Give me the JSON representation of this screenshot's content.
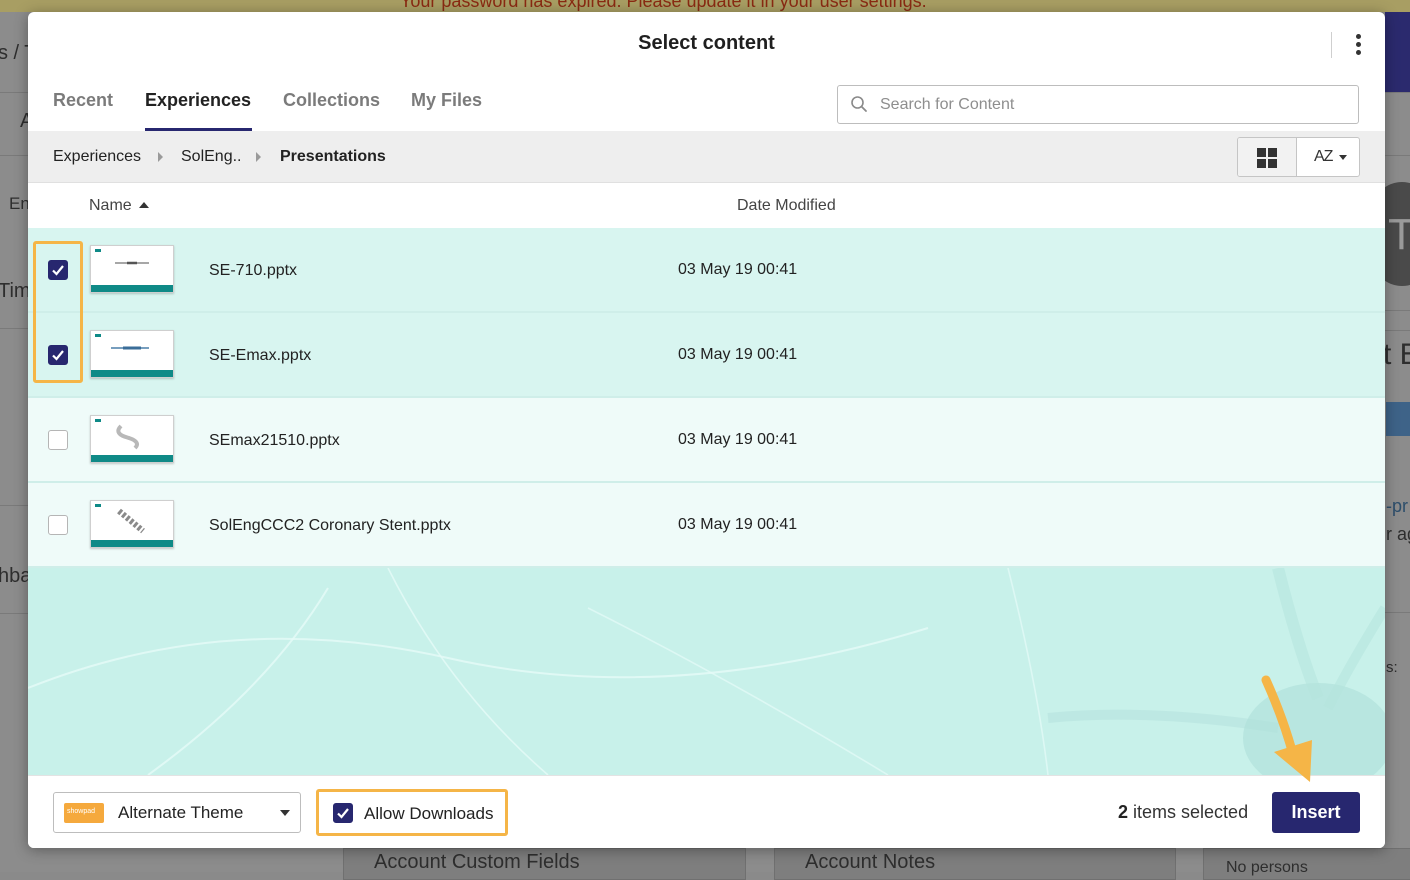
{
  "background": {
    "banner_text": "Your password has expired. Please update it in your user settings.",
    "left_fragments": [
      "s / T",
      "A",
      "En",
      "Tim",
      "hba"
    ],
    "right_fragments": [
      "T",
      "t E",
      "-pr",
      "r ag",
      "s:"
    ],
    "bottom_cards": [
      "Account Custom Fields",
      "Account Notes",
      "No persons"
    ]
  },
  "modal": {
    "title": "Select content",
    "menu_icon": "kebab-vertical-icon"
  },
  "tabs": [
    {
      "label": "Recent",
      "active": false
    },
    {
      "label": "Experiences",
      "active": true
    },
    {
      "label": "Collections",
      "active": false
    },
    {
      "label": "My Files",
      "active": false
    }
  ],
  "search": {
    "placeholder": "Search for Content",
    "value": ""
  },
  "breadcrumb": [
    "Experiences",
    "SolEng..",
    "Presentations"
  ],
  "view_controls": {
    "grid_icon": "grid-view-icon",
    "sort_label": "AZ"
  },
  "columns": {
    "name": "Name",
    "date_modified": "Date Modified"
  },
  "files": [
    {
      "name": "SE-710.pptx",
      "date": "03 May 19 00:41",
      "checked": true
    },
    {
      "name": "SE-Emax.pptx",
      "date": "03 May 19 00:41",
      "checked": true
    },
    {
      "name": "SEmax21510.pptx",
      "date": "03 May 19 00:41",
      "checked": false
    },
    {
      "name": "SolEngCCC2 Coronary Stent.pptx",
      "date": "03 May 19 00:41",
      "checked": false
    }
  ],
  "footer": {
    "theme": {
      "label": "Alternate Theme",
      "swatch_text": "showpad"
    },
    "allow_downloads": {
      "label": "Allow Downloads",
      "checked": true
    },
    "selected_count": "2",
    "selected_suffix": "items selected",
    "insert_label": "Insert"
  },
  "colors": {
    "accent": "#27276f",
    "highlight": "#f5b547",
    "row_selected": "#d8f5f0",
    "teal": "#0f8a87"
  }
}
